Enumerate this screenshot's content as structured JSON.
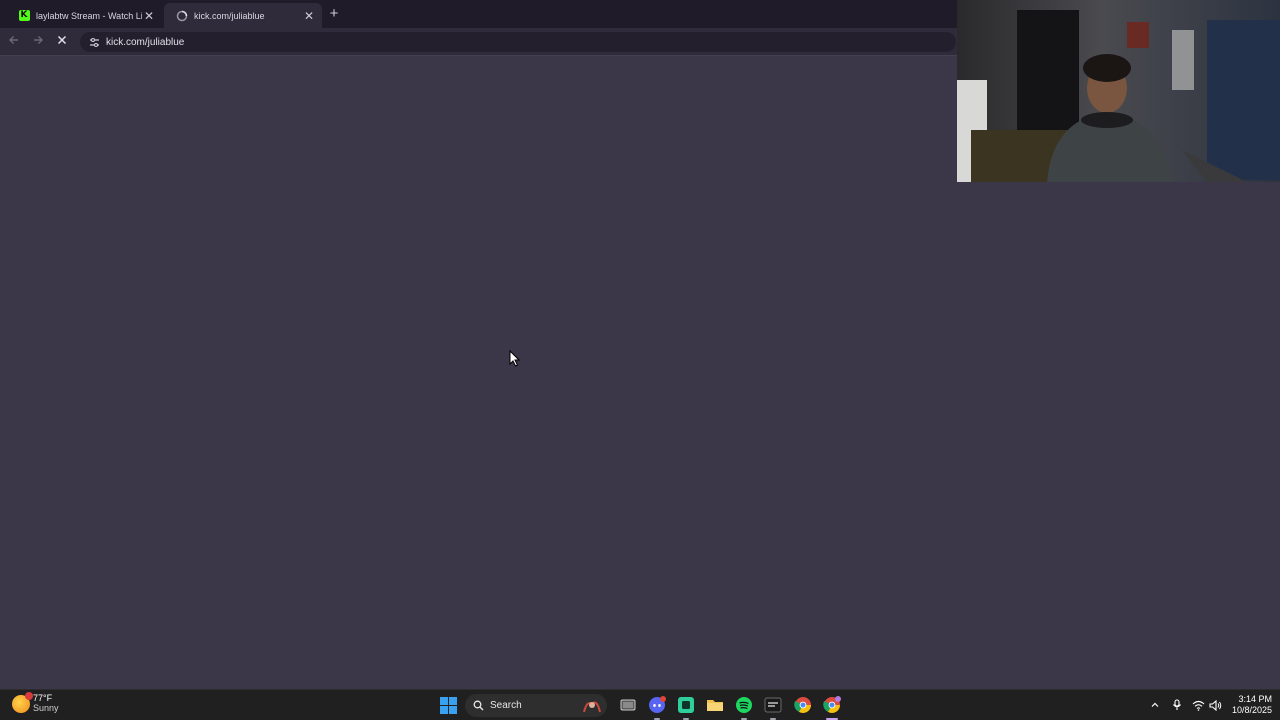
{
  "browser": {
    "tabs": [
      {
        "title": "laylabtw Stream - Watch Live o",
        "favicon": "kick-k-icon",
        "active": false
      },
      {
        "title": "kick.com/juliablue",
        "favicon": "loading-spinner-icon",
        "active": true
      }
    ],
    "new_tab_icon": "plus-icon",
    "toolbar": {
      "back_icon": "arrow-left-icon",
      "forward_icon": "arrow-right-icon",
      "stop_icon": "close-icon",
      "site_info_icon": "tune-icon",
      "url": "kick.com/juliablue"
    }
  },
  "page": {
    "background_color": "#3c3649",
    "state": "loading"
  },
  "webcam": {
    "description_icon": "webcam-feed"
  },
  "taskbar": {
    "weather": {
      "temp": "77°F",
      "condition": "Sunny"
    },
    "search_placeholder": "Search",
    "pinned_apps": [
      "file-explorer-task-view-icon",
      "discord-icon",
      "app-green-icon",
      "folder-icon",
      "spotify-icon",
      "app-dark-icon",
      "chrome-icon",
      "chrome-profile-icon"
    ],
    "clock": {
      "time": "3:14 PM",
      "date": "10/8/2025"
    }
  },
  "colors": {
    "kick_green": "#53fc18",
    "windows_blue": "#3aa0f0",
    "spotify_green": "#1ed760",
    "discord_blurple": "#5865f2"
  }
}
